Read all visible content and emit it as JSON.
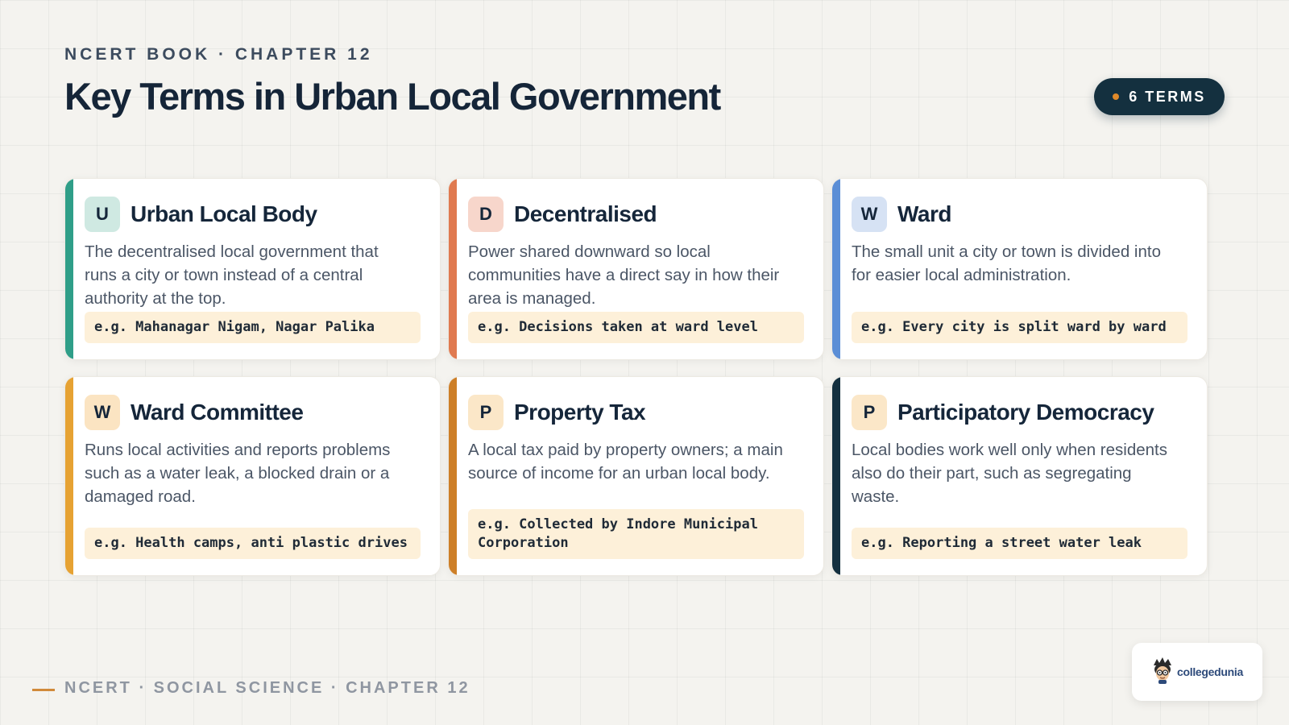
{
  "header": {
    "kicker": "NCERT BOOK · CHAPTER 12",
    "title": "Key Terms in Urban Local Government",
    "badge_label": "6 TERMS",
    "badge_dot_color": "#e08a2a"
  },
  "cards": [
    {
      "letter": "U",
      "term": "Urban Local Body",
      "description": "The decentralised local government that runs a city or town instead of a central authority at the top.",
      "example": "e.g. Mahanagar Nigam, Nagar Palika",
      "accent_color": "#2f9e88",
      "letter_bg": "#cfe9e2"
    },
    {
      "letter": "D",
      "term": "Decentralised",
      "description": "Power shared downward so local communities have a direct say in how their area is managed.",
      "example": "e.g. Decisions taken at ward level",
      "accent_color": "#e07a50",
      "letter_bg": "#f7d6cb"
    },
    {
      "letter": "W",
      "term": "Ward",
      "description": "The small unit a city or town is divided into for easier local administration.",
      "example": "e.g. Every city is split ward by ward",
      "accent_color": "#5b8ed6",
      "letter_bg": "#d6e2f4"
    },
    {
      "letter": "W",
      "term": "Ward Committee",
      "description": "Runs local activities and reports problems such as a water leak, a blocked drain or a damaged road.",
      "example": "e.g. Health camps, anti plastic drives",
      "accent_color": "#e6a233",
      "letter_bg": "#fbe4c2"
    },
    {
      "letter": "P",
      "term": "Property Tax",
      "description": "A local tax paid by property owners; a main source of income for an urban local body.",
      "example": "e.g. Collected by Indore Municipal Corporation",
      "accent_color": "#cd7f28",
      "letter_bg": "#fbe7c8"
    },
    {
      "letter": "P",
      "term": "Participatory Democracy",
      "description": "Local bodies work well only when residents also do their part, such as segregating waste.",
      "example": "e.g. Reporting a street water leak",
      "accent_color": "#14303f",
      "letter_bg": "#fbe7c8"
    }
  ],
  "footer": {
    "text": "NCERT · SOCIAL SCIENCE · CHAPTER 12",
    "logo_text": "collegedunia"
  }
}
